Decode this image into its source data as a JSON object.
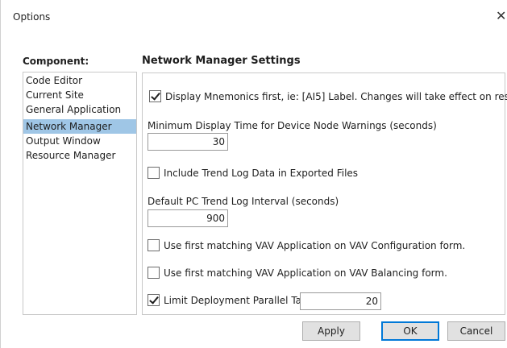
{
  "window": {
    "title": "Options",
    "close_glyph": "✕"
  },
  "component": {
    "label": "Component:",
    "items": [
      {
        "label": "Code Editor",
        "selected": false
      },
      {
        "label": "Current Site",
        "selected": false
      },
      {
        "label": "General Application",
        "selected": false
      },
      {
        "label": "Network Manager",
        "selected": true
      },
      {
        "label": "Output Window",
        "selected": false
      },
      {
        "label": "Resource Manager",
        "selected": false
      }
    ]
  },
  "settings": {
    "title": "Network Manager Settings",
    "display_mnemonics": {
      "label": "Display Mnemonics first, ie: [AI5] Label.  Changes will take effect on restart.",
      "checked": true
    },
    "min_display_time": {
      "label": "Minimum Display Time for Device Node Warnings (seconds)",
      "value": "30"
    },
    "include_trend_log": {
      "label": "Include Trend Log Data in Exported Files",
      "checked": false
    },
    "default_trend_interval": {
      "label": "Default PC Trend Log Interval (seconds)",
      "value": "900"
    },
    "vav_config": {
      "label": "Use first matching VAV Application on VAV Configuration form.",
      "checked": false
    },
    "vav_balancing": {
      "label": "Use first matching VAV Application on VAV Balancing form.",
      "checked": false
    },
    "limit_parallel": {
      "label": "Limit Deployment Parallel Tasks",
      "checked": true,
      "value": "20"
    }
  },
  "buttons": {
    "apply": "Apply",
    "ok": "OK",
    "cancel": "Cancel"
  },
  "colors": {
    "selection": "#9fc6e6",
    "default_button_border": "#0078d7"
  }
}
